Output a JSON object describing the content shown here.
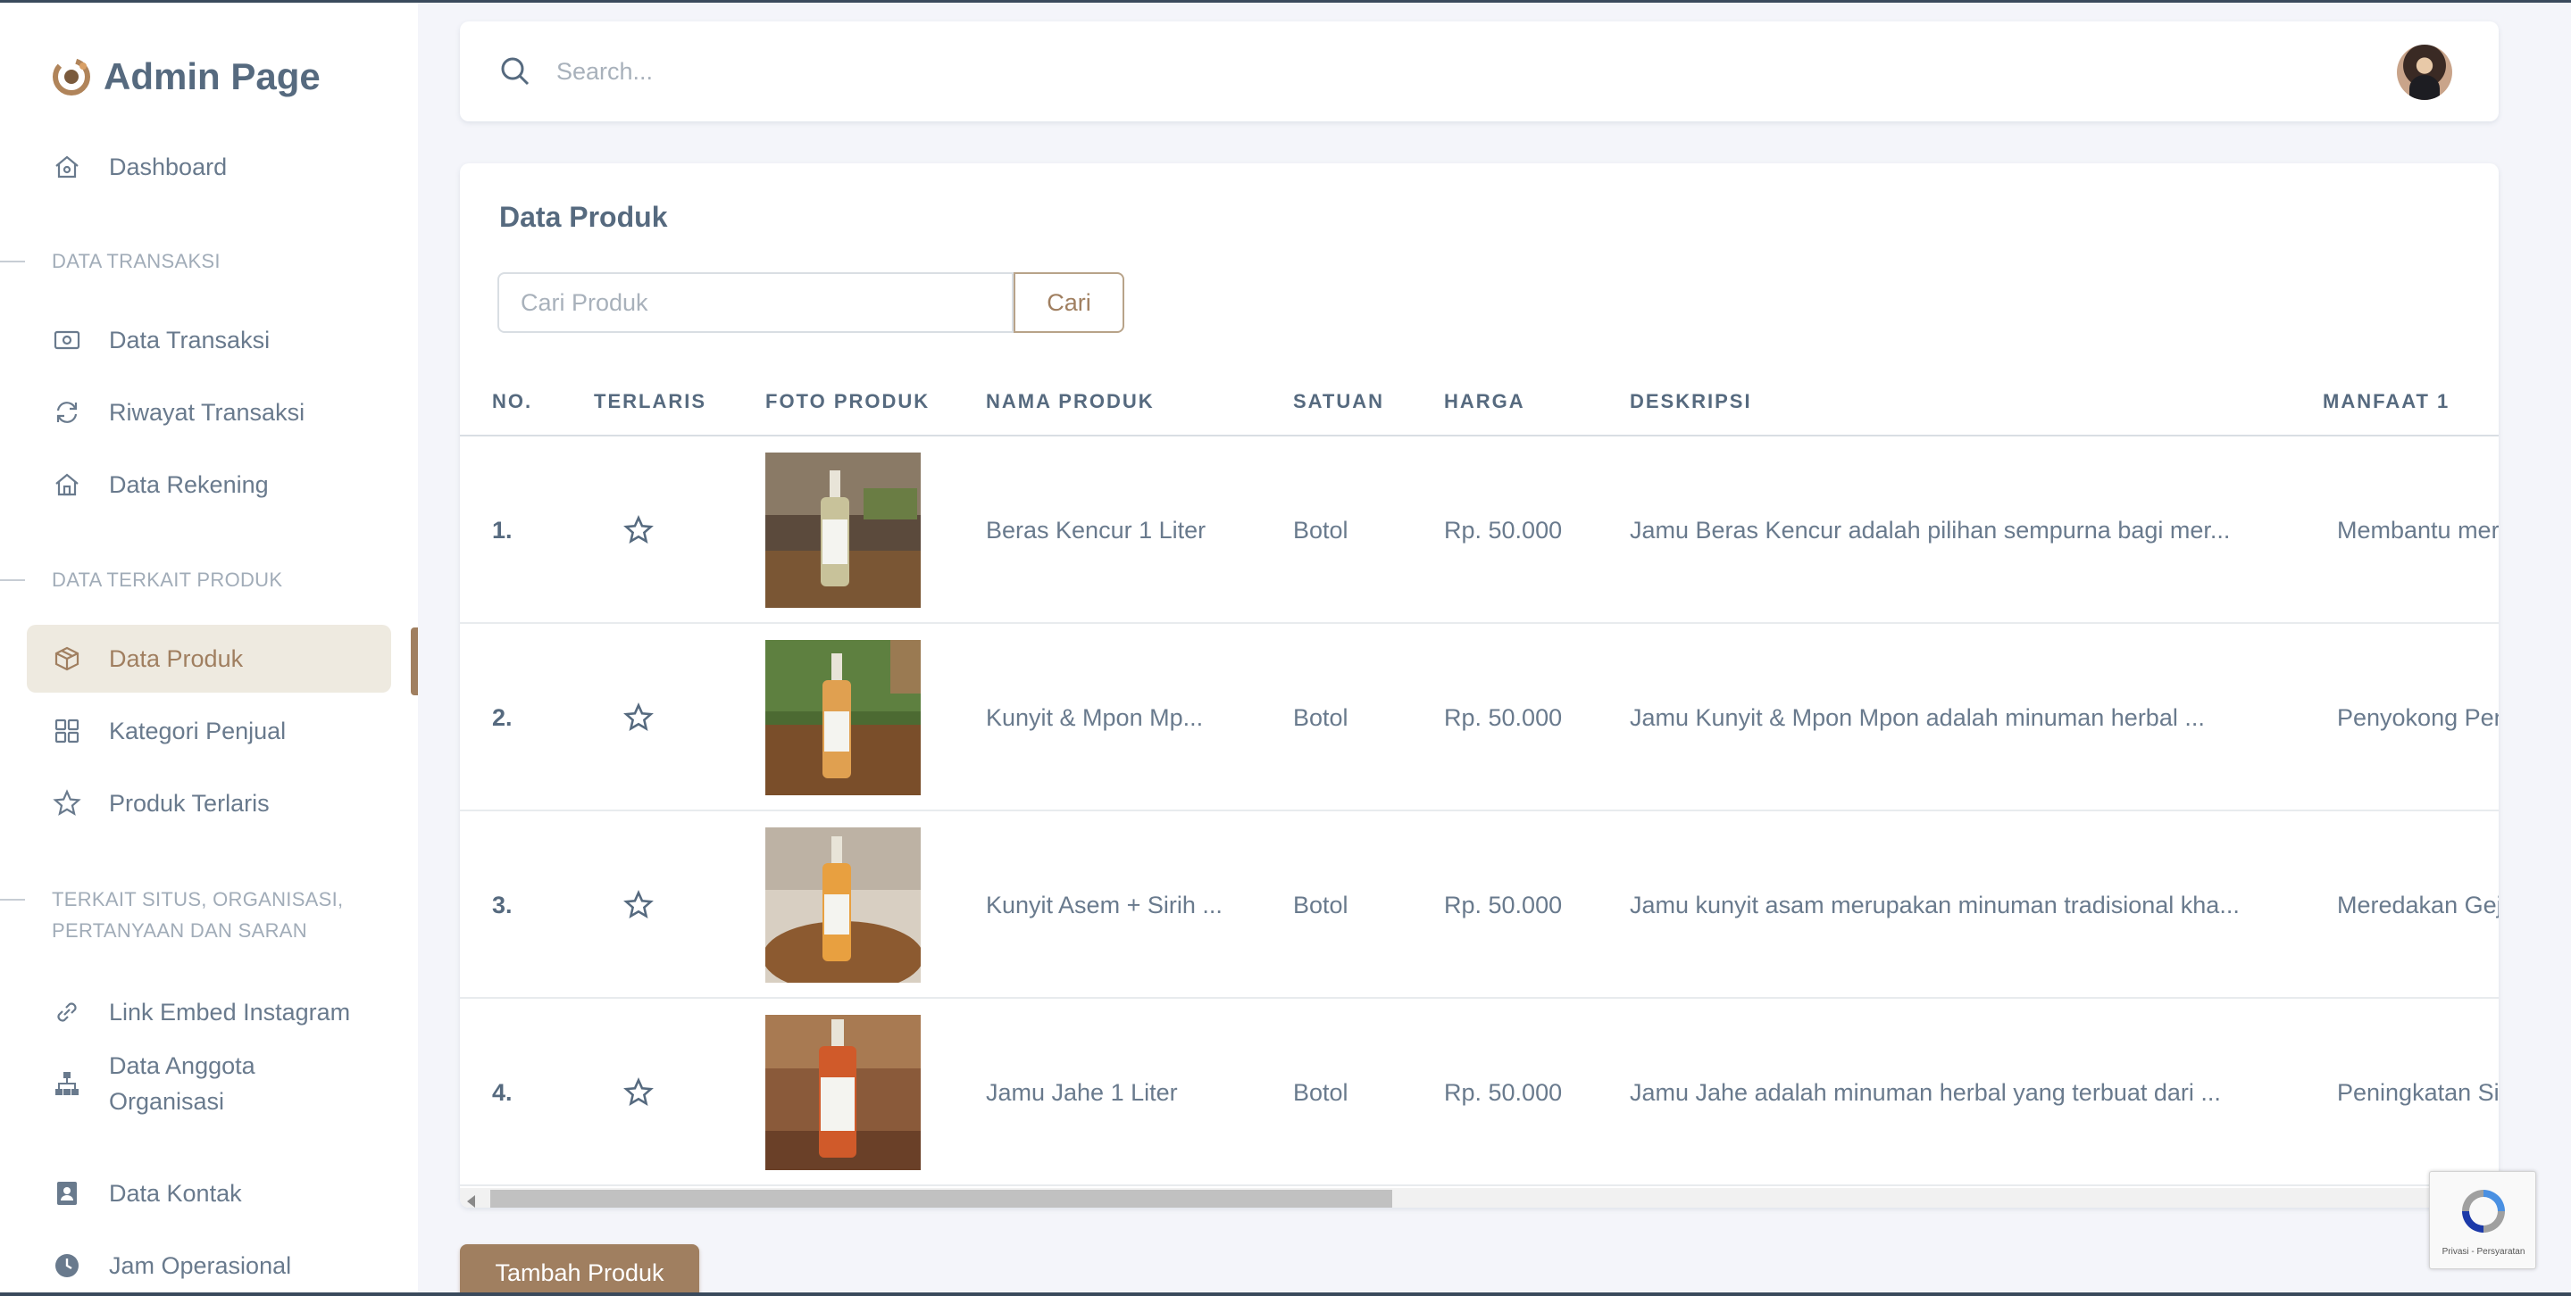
{
  "brand": {
    "title": "Admin Page"
  },
  "sidebar": {
    "items": [
      {
        "label": "Dashboard",
        "icon": "home-icon"
      },
      {
        "header": "DATA TRANSAKSI"
      },
      {
        "label": "Data Transaksi",
        "icon": "money-icon"
      },
      {
        "label": "Riwayat Transaksi",
        "icon": "refresh-icon"
      },
      {
        "label": "Data Rekening",
        "icon": "bank-icon"
      },
      {
        "header": "DATA TERKAIT PRODUK"
      },
      {
        "label": "Data Produk",
        "icon": "box-icon",
        "active": true
      },
      {
        "label": "Kategori Penjual",
        "icon": "grid-icon"
      },
      {
        "label": "Produk Terlaris",
        "icon": "star-icon"
      },
      {
        "header": "TERKAIT SITUS, ORGANISASI, PERTANYAAN DAN SARAN"
      },
      {
        "label": "Link Embed Instagram",
        "icon": "link-icon"
      },
      {
        "label": "Data Anggota Organisasi",
        "icon": "sitemap-icon"
      },
      {
        "label": "Data Kontak",
        "icon": "contact-icon"
      },
      {
        "label": "Jam Operasional",
        "icon": "clock-icon"
      }
    ]
  },
  "navbar": {
    "search_placeholder": "Search..."
  },
  "card": {
    "title": "Data Produk",
    "filter_placeholder": "Cari Produk",
    "filter_button": "Cari",
    "columns": [
      "NO.",
      "TERLARIS",
      "FOTO PRODUK",
      "NAMA PRODUK",
      "SATUAN",
      "HARGA",
      "DESKRIPSI",
      "MANFAAT 1"
    ],
    "rows": [
      {
        "no": "1.",
        "name": "Beras Kencur 1 Liter",
        "unit": "Botol",
        "price": "Rp. 50.000",
        "desc": "Jamu Beras Kencur adalah pilihan sempurna bagi mer...",
        "benefit": "Membantu mere"
      },
      {
        "no": "2.",
        "name": "Kunyit & Mpon Mp...",
        "unit": "Botol",
        "price": "Rp. 50.000",
        "desc": "Jamu Kunyit & Mpon Mpon adalah minuman herbal ...",
        "benefit": "Penyokong Pend"
      },
      {
        "no": "3.",
        "name": "Kunyit Asem + Sirih ...",
        "unit": "Botol",
        "price": "Rp. 50.000",
        "desc": "Jamu kunyit asam merupakan minuman tradisional kha...",
        "benefit": "Meredakan Geja"
      },
      {
        "no": "4.",
        "name": "Jamu Jahe 1 Liter",
        "unit": "Botol",
        "price": "Rp. 50.000",
        "desc": "Jamu Jahe adalah minuman herbal yang terbuat dari ...",
        "benefit": "Peningkatan Sis"
      }
    ]
  },
  "add_button": "Tambah Produk",
  "recaptcha": {
    "text": "Privasi - Persyaratan"
  },
  "colors": {
    "accent": "#a07f60",
    "active_bg": "#eeeae0",
    "page_bg": "#f4f5fa"
  }
}
